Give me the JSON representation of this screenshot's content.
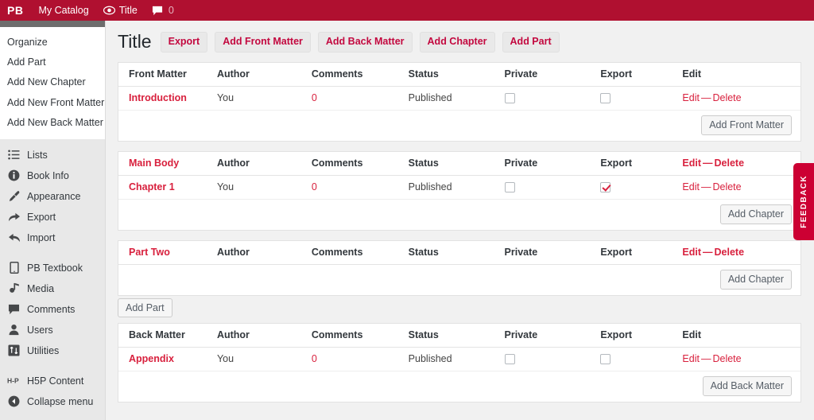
{
  "adminbar": {
    "logo": "PB",
    "items": [
      {
        "label": "My Catalog",
        "icon": ""
      },
      {
        "label": "Title",
        "icon": "eye-icon"
      },
      {
        "label": "",
        "icon": "comment-icon",
        "count": "0"
      }
    ]
  },
  "sidebar": {
    "submenu": [
      {
        "label": "Organize"
      },
      {
        "label": "Add Part"
      },
      {
        "label": "Add New Chapter"
      },
      {
        "label": "Add New Front Matter"
      },
      {
        "label": "Add New Back Matter"
      }
    ],
    "group1": [
      {
        "label": "Lists",
        "icon": "list-icon"
      },
      {
        "label": "Book Info",
        "icon": "info-icon"
      },
      {
        "label": "Appearance",
        "icon": "brush-icon"
      },
      {
        "label": "Export",
        "icon": "export-arrow-icon"
      },
      {
        "label": "Import",
        "icon": "import-arrow-icon"
      }
    ],
    "group2": [
      {
        "label": "PB Textbook",
        "icon": "tablet-icon"
      },
      {
        "label": "Media",
        "icon": "media-icon"
      },
      {
        "label": "Comments",
        "icon": "comment-icon"
      },
      {
        "label": "Users",
        "icon": "user-icon"
      },
      {
        "label": "Utilities",
        "icon": "utilities-icon"
      }
    ],
    "group3": [
      {
        "label": "H5P Content",
        "icon": "h5p-icon"
      },
      {
        "label": "Collapse menu",
        "icon": "collapse-arrow-icon"
      }
    ]
  },
  "page": {
    "title": "Title",
    "buttons": [
      {
        "label": "Export"
      },
      {
        "label": "Add Front Matter"
      },
      {
        "label": "Add Back Matter"
      },
      {
        "label": "Add Chapter"
      },
      {
        "label": "Add Part"
      }
    ]
  },
  "columns": {
    "author": "Author",
    "comments": "Comments",
    "status": "Status",
    "private": "Private",
    "export": "Export",
    "edit": "Edit",
    "edit_delete_edit": "Edit",
    "edit_delete_dash": "—",
    "edit_delete_delete": "Delete"
  },
  "sections": {
    "front_matter": {
      "header_title": "Front Matter",
      "header_edit": "Edit",
      "rows": [
        {
          "title": "Introduction",
          "author": "You",
          "comments": "0",
          "status": "Published",
          "private_checked": false,
          "export_checked": false,
          "edit": "Edit",
          "dash": "—",
          "delete": "Delete"
        }
      ],
      "add_button": "Add Front Matter"
    },
    "main_body": {
      "header_title": "Main Body",
      "header_edit": "Edit",
      "header_dash": "—",
      "header_delete": "Delete",
      "rows": [
        {
          "title": "Chapter 1",
          "author": "You",
          "comments": "0",
          "status": "Published",
          "private_checked": false,
          "export_checked": true,
          "edit": "Edit",
          "dash": "—",
          "delete": "Delete"
        }
      ],
      "add_button": "Add Chapter"
    },
    "part_two": {
      "header_title": "Part Two",
      "header_edit": "Edit",
      "header_dash": "—",
      "header_delete": "Delete",
      "add_button": "Add Chapter"
    },
    "add_part_button": "Add Part",
    "back_matter": {
      "header_title": "Back Matter",
      "header_edit": "Edit",
      "rows": [
        {
          "title": "Appendix",
          "author": "You",
          "comments": "0",
          "status": "Published",
          "private_checked": false,
          "export_checked": false,
          "edit": "Edit",
          "dash": "—",
          "delete": "Delete"
        }
      ],
      "add_button": "Add Back Matter"
    }
  },
  "feedback": {
    "label": "FEEDBACK"
  },
  "colors": {
    "adminbar_red": "#b01030",
    "link_red": "#d8203d",
    "button_red": "#c3083f",
    "feedback_red": "#cc0033",
    "sidebar_bg": "#e8e8e8",
    "content_bg": "#f1f1f1"
  }
}
